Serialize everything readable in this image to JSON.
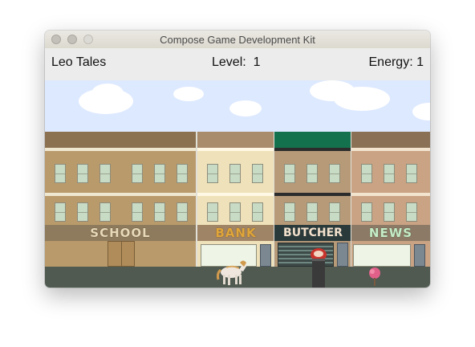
{
  "window": {
    "title": "Compose Game Development Kit"
  },
  "hud": {
    "name": "Leo Tales",
    "level_label": "Level:",
    "level_value": "1",
    "energy_label": "Energy:",
    "energy_value": "1"
  },
  "buildings": {
    "school": {
      "sign": "SCHOOL",
      "color": "#b99a6b"
    },
    "bank": {
      "sign": "BANK",
      "color": "#efe2ba"
    },
    "butcher": {
      "sign": "BUTCHER",
      "color": "#b79a78"
    },
    "news": {
      "sign": "NEWS",
      "color": "#c9a383"
    }
  },
  "sprites": {
    "player": "pony-sprite",
    "bin": "trash-bin-with-food",
    "flower": "pink-flower"
  }
}
